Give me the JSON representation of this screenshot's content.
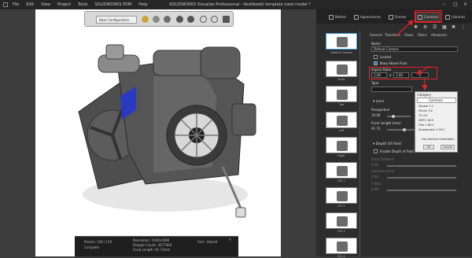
{
  "menu": {
    "items": [
      "File",
      "Edit",
      "View",
      "Project",
      "Tools",
      "SOLIDWORKS PDM",
      "Help"
    ]
  },
  "window": {
    "title": "SOLIDWORKS Visualize Professional - Vestibeekt template inset model *"
  },
  "viewport": {
    "config_select": "Base Configuration"
  },
  "status": {
    "passes": "Passes: 158 / 120",
    "state": "Complete",
    "resolution": "Resolution: 1920x1080",
    "polygons": "Polygon Count: 3077464",
    "focal": "Focal Length: 91.73mm",
    "mode": "Fast - Hybrid"
  },
  "right_tabs": {
    "models": "Models",
    "appearances": "Appearances",
    "scenes": "Scenes",
    "cameras": "Cameras",
    "libraries": "Libraries"
  },
  "thumbnails": [
    {
      "label": "Default Camera"
    },
    {
      "label": "Front"
    },
    {
      "label": "Top"
    },
    {
      "label": "Left"
    },
    {
      "label": "Right"
    },
    {
      "label": "ISO 1"
    },
    {
      "label": "ISO 2"
    },
    {
      "label": "ISO 3"
    },
    {
      "label": "ISO 4"
    }
  ],
  "props": {
    "tabs": [
      "General",
      "Transform",
      "Views",
      "Filters",
      "Advanced"
    ],
    "name_label": "Name",
    "name_value": "Default Camera",
    "locked": "Locked",
    "keep_above_floor": "Keep Above Floor",
    "aspect_label": "Aspect Ratio",
    "aspect_w": "1.00",
    "aspect_x": "x",
    "aspect_h": "1.00",
    "aspect_btn": "▾",
    "type_label": "Type",
    "lens_section": "Lens",
    "perspective": "Perspective",
    "persp_val": "10.00",
    "focal_label": "Focal Length (mm)",
    "focal_val": "91.73",
    "dof_section": "Depth Of Field",
    "enable_dof": "Enable Depth of Field",
    "focal_distance": "Focal Distance",
    "focal_dist_val": "0.00",
    "aperture": "Aperture (mm)",
    "aperture_val": "0.00",
    "fstop": "F-Stop",
    "fstop_val": "0.00"
  },
  "category_popup": {
    "label": "Category",
    "selected": "Common",
    "options": [
      "Square 1:1",
      "35mm 3:2",
      "TV 4:3",
      "HDTV 16:9",
      "Film 1.85:1",
      "Anamorphic 2.35:1"
    ],
    "vertical": "Use Vertical Orientation",
    "ok": "OK",
    "cancel": "Cancel"
  }
}
